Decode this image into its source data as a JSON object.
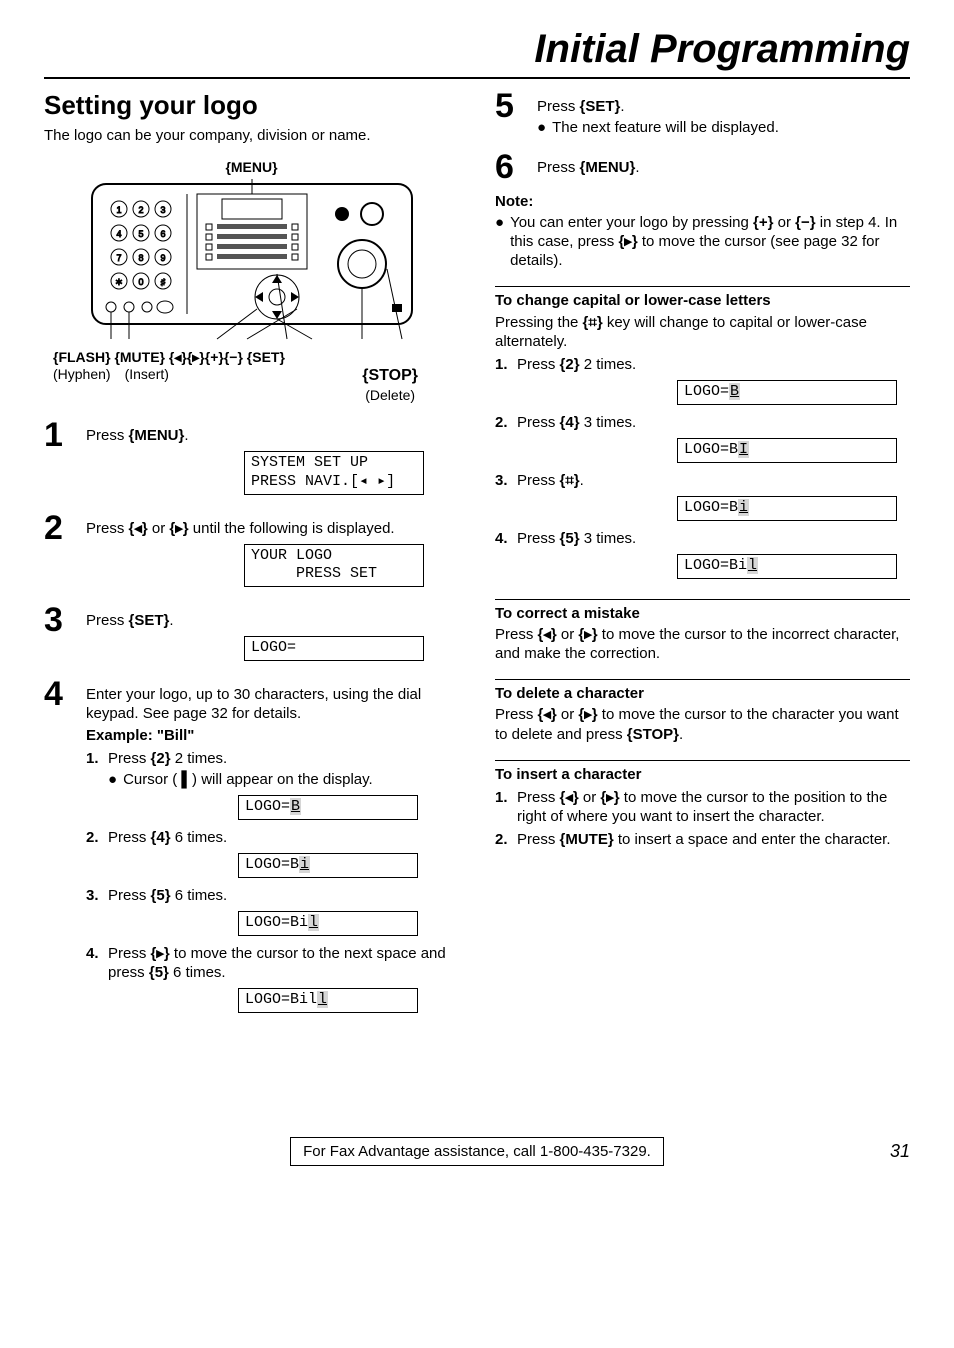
{
  "title": "Initial Programming",
  "section": {
    "heading": "Setting your logo",
    "intro": "The logo can be your company, division or name."
  },
  "figure": {
    "menu_label": "{MENU}",
    "bottom_labels": "{FLASH} {MUTE} {◂}{▸}{+}{−}    {SET}",
    "hyphen": "(Hyphen)",
    "insert": "(Insert)",
    "stop": "{STOP}",
    "delete": "(Delete)"
  },
  "steps": {
    "s1": {
      "text_a": "Press ",
      "key": "{MENU}",
      "text_b": ".",
      "lcd": "SYSTEM SET UP\nPRESS NAVI.[◂ ▸]"
    },
    "s2": {
      "text_a": "Press ",
      "key1": "{◂}",
      "or": " or ",
      "key2": "{▸}",
      "text_b": " until the following is displayed.",
      "lcd": "YOUR LOGO\n     PRESS SET"
    },
    "s3": {
      "text_a": "Press ",
      "key": "{SET}",
      "text_b": ".",
      "lcd": "LOGO="
    },
    "s4": {
      "text": "Enter your logo, up to 30 characters, using the dial keypad. See page 32 for details.",
      "example_label": "Example: \"Bill\"",
      "sub1": {
        "text_a": "Press ",
        "key": "{2}",
        "text_b": " 2 times.",
        "bullet": "Cursor ( ▌) will appear on the display.",
        "lcd": "LOGO=",
        "lcd_ch": "B"
      },
      "sub2": {
        "text_a": "Press ",
        "key": "{4}",
        "text_b": " 6 times.",
        "lcd": "LOGO=B",
        "lcd_ch": "i"
      },
      "sub3": {
        "text_a": "Press ",
        "key": "{5}",
        "text_b": " 6 times.",
        "lcd": "LOGO=Bi",
        "lcd_ch": "l"
      },
      "sub4": {
        "text_a": "Press ",
        "key1": "{▸}",
        "text_b": " to move the cursor to the next space and press ",
        "key2": "{5}",
        "text_c": " 6 times.",
        "lcd": "LOGO=Bil",
        "lcd_ch": "l"
      }
    },
    "s5": {
      "text_a": "Press ",
      "key": "{SET}",
      "text_b": ".",
      "bullet": "The next feature will be displayed."
    },
    "s6": {
      "text_a": "Press ",
      "key": "{MENU}",
      "text_b": "."
    }
  },
  "note": {
    "label": "Note:",
    "text_a": "You can enter your logo by pressing ",
    "key1": "{+}",
    "text_b": " or ",
    "key2": "{−}",
    "text_c": " in step 4. In this case, press ",
    "key3": "{▸}",
    "text_d": " to move the cursor (see page 32 for details)."
  },
  "cap": {
    "head": "To change capital or lower-case letters",
    "text_a": "Pressing the ",
    "key": "{⌗}",
    "text_b": " key will change to capital or lower-case alternately.",
    "sub1": {
      "text_a": "Press ",
      "key": "{2}",
      "text_b": " 2 times.",
      "lcd": "LOGO=",
      "lcd_ch": "B"
    },
    "sub2": {
      "text_a": "Press ",
      "key": "{4}",
      "text_b": " 3 times.",
      "lcd": "LOGO=B",
      "lcd_ch": "I"
    },
    "sub3": {
      "text_a": "Press ",
      "key": "{⌗}",
      "text_b": ".",
      "lcd": "LOGO=B",
      "lcd_ch": "i"
    },
    "sub4": {
      "text_a": "Press ",
      "key": "{5}",
      "text_b": " 3 times.",
      "lcd": "LOGO=Bi",
      "lcd_ch": "l"
    }
  },
  "correct": {
    "head": "To correct a mistake",
    "text_a": "Press ",
    "key1": "{◂}",
    "or": " or ",
    "key2": "{▸}",
    "text_b": " to move the cursor to the incorrect character, and make the correction."
  },
  "delete": {
    "head": "To delete a character",
    "text_a": "Press ",
    "key1": "{◂}",
    "or": " or ",
    "key2": "{▸}",
    "text_b": " to move the cursor to the character you want to delete and press ",
    "key3": "{STOP}",
    "text_c": "."
  },
  "insert": {
    "head": "To insert a character",
    "sub1": {
      "text_a": "Press ",
      "key1": "{◂}",
      "or": " or ",
      "key2": "{▸}",
      "text_b": " to move the cursor to the position to the right of where you want to insert the character."
    },
    "sub2": {
      "text_a": "Press ",
      "key": "{MUTE}",
      "text_b": " to insert a space and enter the character."
    }
  },
  "footer": {
    "text": "For Fax Advantage assistance, call 1-800-435-7329.",
    "page": "31"
  }
}
